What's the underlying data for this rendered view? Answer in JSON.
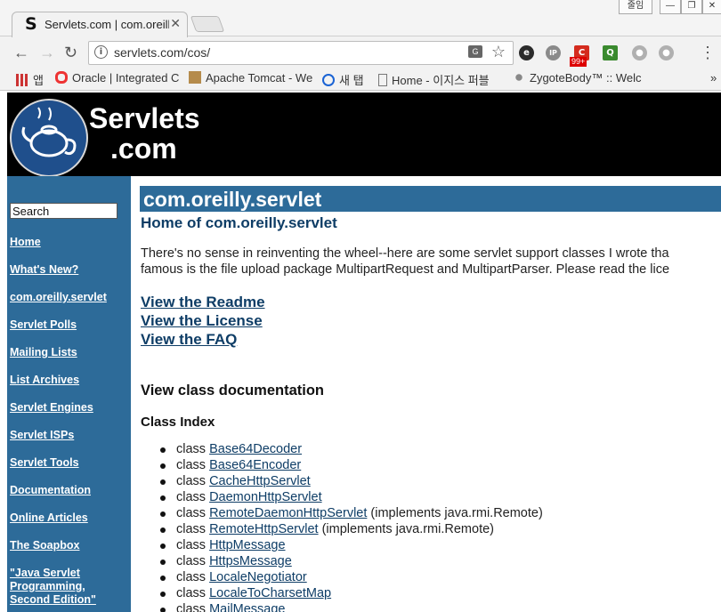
{
  "browser": {
    "tab_title": "Servlets.com | com.oreill",
    "tab_favicon": "S",
    "close_glyph": "✕",
    "window_buttons": [
      "줄임",
      "—",
      "❐",
      "✕"
    ],
    "url": "servlets.com/cos/",
    "info_glyph": "i",
    "translate_glyph": "G",
    "star_glyph": "☆",
    "menu_glyph": "⋮",
    "back_glyph": "←",
    "forward_glyph": "→",
    "reload_glyph": "↻",
    "extensions": [
      {
        "icon": "e-extension-icon",
        "glyph": "e",
        "color": "#2b2b2b"
      },
      {
        "icon": "ip-extension-icon",
        "glyph": "IP",
        "color": "#8a8a8a"
      },
      {
        "icon": "red-c-extension-icon",
        "glyph": "C",
        "color": "#d42b1e"
      },
      {
        "icon": "search-extension-icon",
        "glyph": "Q",
        "color": "#3a8a2e"
      },
      {
        "icon": "grey-extension-icon",
        "glyph": "●",
        "color": "#b0b0b0"
      },
      {
        "icon": "grey-extension-icon-2",
        "glyph": "●",
        "color": "#b0b0b0"
      }
    ],
    "ext_badge": "99+",
    "bookmarks": [
      {
        "label": "앱",
        "icon": "apps-grid-icon"
      },
      {
        "label": "Oracle | Integrated C",
        "icon": "oracle-icon"
      },
      {
        "label": "Apache Tomcat - We",
        "icon": "tomcat-icon"
      },
      {
        "label": "새 탭",
        "icon": "search-icon"
      },
      {
        "label": "Home - 이지스 퍼블",
        "icon": "page-icon"
      },
      {
        "label": "ZygoteBody™ :: Welc",
        "icon": "zygote-icon"
      }
    ],
    "bookmarks_overflow": "»"
  },
  "banner": {
    "logo_line1": "Servlets",
    "logo_line2": ".com"
  },
  "sidebar": {
    "search_value": "Search",
    "links": [
      "Home",
      "What's New?",
      "com.oreilly.servlet",
      "Servlet Polls",
      "Mailing Lists",
      "List Archives",
      "Servlet Engines",
      "Servlet ISPs",
      "Servlet Tools",
      "Documentation",
      "Online Articles",
      "The Soapbox",
      "\"Java Servlet Programming, Second Edition\""
    ]
  },
  "main": {
    "title": "com.oreilly.servlet",
    "subtitle": "Home of com.oreilly.servlet",
    "intro_line1": "There's no sense in reinventing the wheel--here are some servlet support classes I wrote tha",
    "intro_line2": "famous is the file upload package MultipartRequest and MultipartParser. Please read the lice",
    "links": [
      "View the Readme",
      "View the License",
      "View the FAQ"
    ],
    "section_heading": "View class documentation",
    "index_heading": "Class Index",
    "class_prefix": "class ",
    "classes": [
      {
        "name": "Base64Decoder",
        "suffix": ""
      },
      {
        "name": "Base64Encoder",
        "suffix": ""
      },
      {
        "name": "CacheHttpServlet",
        "suffix": ""
      },
      {
        "name": "DaemonHttpServlet",
        "suffix": ""
      },
      {
        "name": "RemoteDaemonHttpServlet",
        "suffix": " (implements java.rmi.Remote)"
      },
      {
        "name": "RemoteHttpServlet",
        "suffix": " (implements java.rmi.Remote)"
      },
      {
        "name": "HttpMessage",
        "suffix": ""
      },
      {
        "name": "HttpsMessage",
        "suffix": ""
      },
      {
        "name": "LocaleNegotiator",
        "suffix": ""
      },
      {
        "name": "LocaleToCharsetMap",
        "suffix": ""
      },
      {
        "name": "MailMessage",
        "suffix": ""
      }
    ]
  }
}
